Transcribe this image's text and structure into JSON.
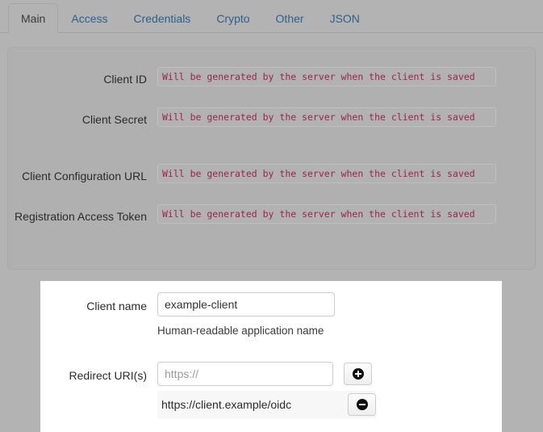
{
  "tabs": [
    {
      "label": "Main",
      "active": true
    },
    {
      "label": "Access",
      "active": false
    },
    {
      "label": "Credentials",
      "active": false
    },
    {
      "label": "Crypto",
      "active": false
    },
    {
      "label": "Other",
      "active": false
    },
    {
      "label": "JSON",
      "active": false
    }
  ],
  "readonly_fields": [
    {
      "label": "Client ID",
      "value": "Will be generated by the server when the client is saved"
    },
    {
      "label": "Client Secret",
      "value": "Will be generated by the server when the client is saved"
    },
    {
      "label": "Client Configuration URL",
      "value": "Will be generated by the server when the client is saved"
    },
    {
      "label": "Registration Access Token",
      "value": "Will be generated by the server when the client is saved"
    }
  ],
  "form": {
    "client_name": {
      "label": "Client name",
      "value": "example-client",
      "help": "Human-readable application name"
    },
    "redirect_uris": {
      "label": "Redirect URI(s)",
      "new_value": "",
      "new_placeholder": "https://",
      "add_button_label": "add-redirect-uri",
      "remove_button_label": "remove-redirect-uri",
      "items": [
        {
          "value": "https://client.example/oidc"
        }
      ]
    }
  },
  "colors": {
    "page_background": "#b3b3b3",
    "panel_background": "#b0b0b0",
    "form_background": "#ffffff",
    "link": "#2f5f8f",
    "readonly_text": "#9c2449"
  }
}
